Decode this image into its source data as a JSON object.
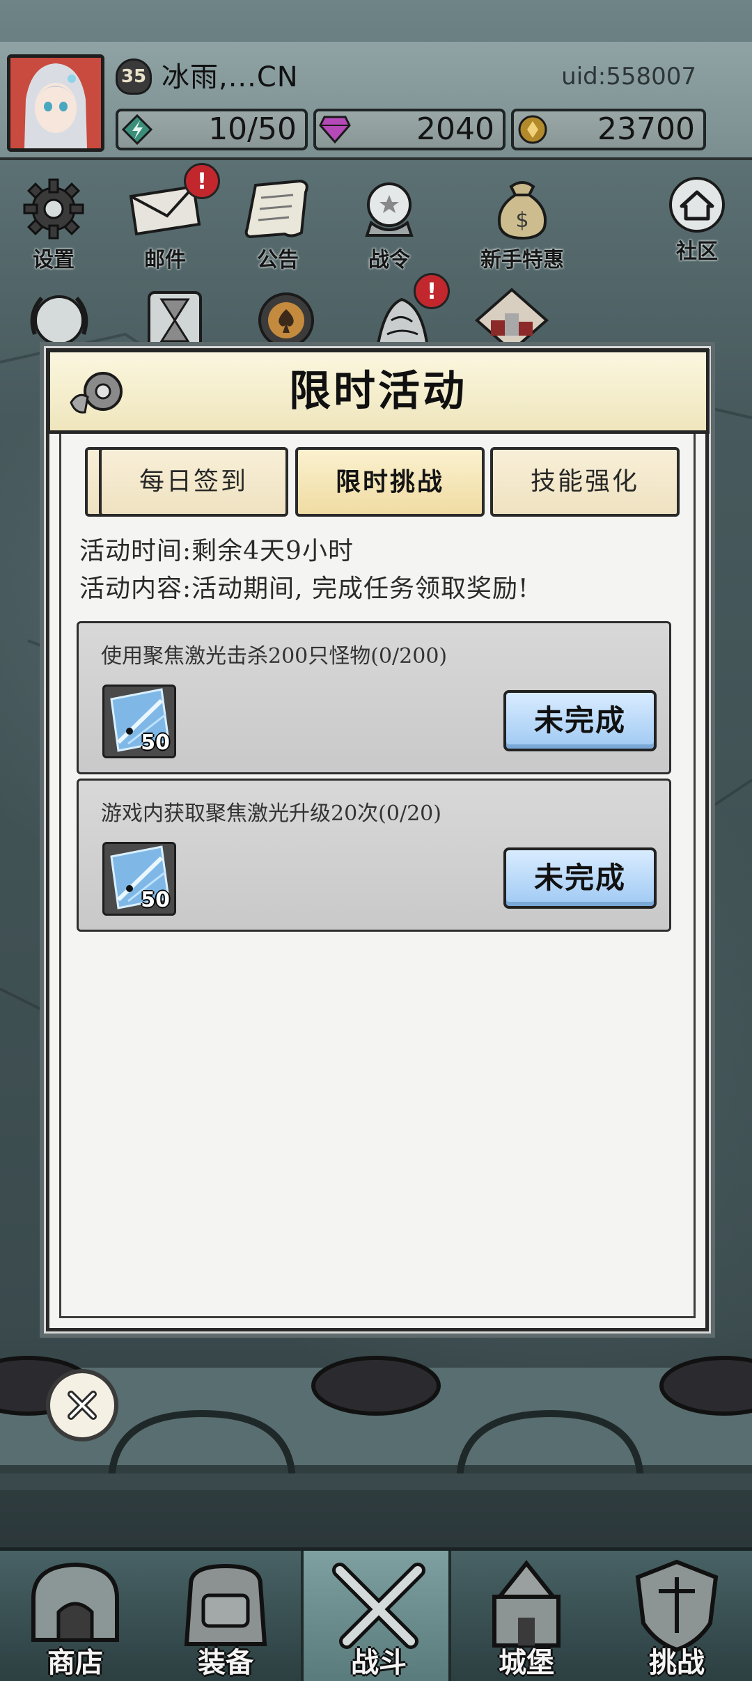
{
  "player": {
    "level": "35",
    "name": "冰雨,...CN",
    "uid": "uid:558007"
  },
  "resources": {
    "energy": "10/50",
    "gems": "2040",
    "gold": "23700"
  },
  "top_menu": [
    {
      "label": "设置",
      "icon": "gear-icon"
    },
    {
      "label": "邮件",
      "icon": "envelope-icon",
      "badge": "!"
    },
    {
      "label": "公告",
      "icon": "scroll-icon"
    },
    {
      "label": "战令",
      "icon": "crystal-ball-icon"
    },
    {
      "label": "新手特惠",
      "icon": "money-bag-icon"
    },
    {
      "label": "社区",
      "icon": "home-icon"
    }
  ],
  "second_row_badge": "!",
  "modal": {
    "title": "限时活动",
    "tabs": [
      {
        "label": "每日签到",
        "active": false
      },
      {
        "label": "限时挑战",
        "active": true
      },
      {
        "label": "技能强化",
        "active": false
      }
    ],
    "time_line": "活动时间:剩余4天9小时",
    "content_line": "活动内容:活动期间, 完成任务领取奖励!",
    "tasks": [
      {
        "title": "使用聚焦激光击杀200只怪物(0/200)",
        "reward_count": "50",
        "status": "未完成"
      },
      {
        "title": "游戏内获取聚焦激光升级20次(0/20)",
        "reward_count": "50",
        "status": "未完成"
      }
    ]
  },
  "bottom_nav": [
    {
      "label": "商店",
      "icon": "shop-icon",
      "active": false
    },
    {
      "label": "装备",
      "icon": "backpack-icon",
      "active": false
    },
    {
      "label": "战斗",
      "icon": "crossed-swords-icon",
      "active": true
    },
    {
      "label": "城堡",
      "icon": "castle-icon",
      "active": false
    },
    {
      "label": "挑战",
      "icon": "shield-icon",
      "active": false
    }
  ],
  "colors": {
    "tab_active": "#f0dca3",
    "status_button": "#9fc9f3",
    "notice_badge": "#c1272d"
  }
}
